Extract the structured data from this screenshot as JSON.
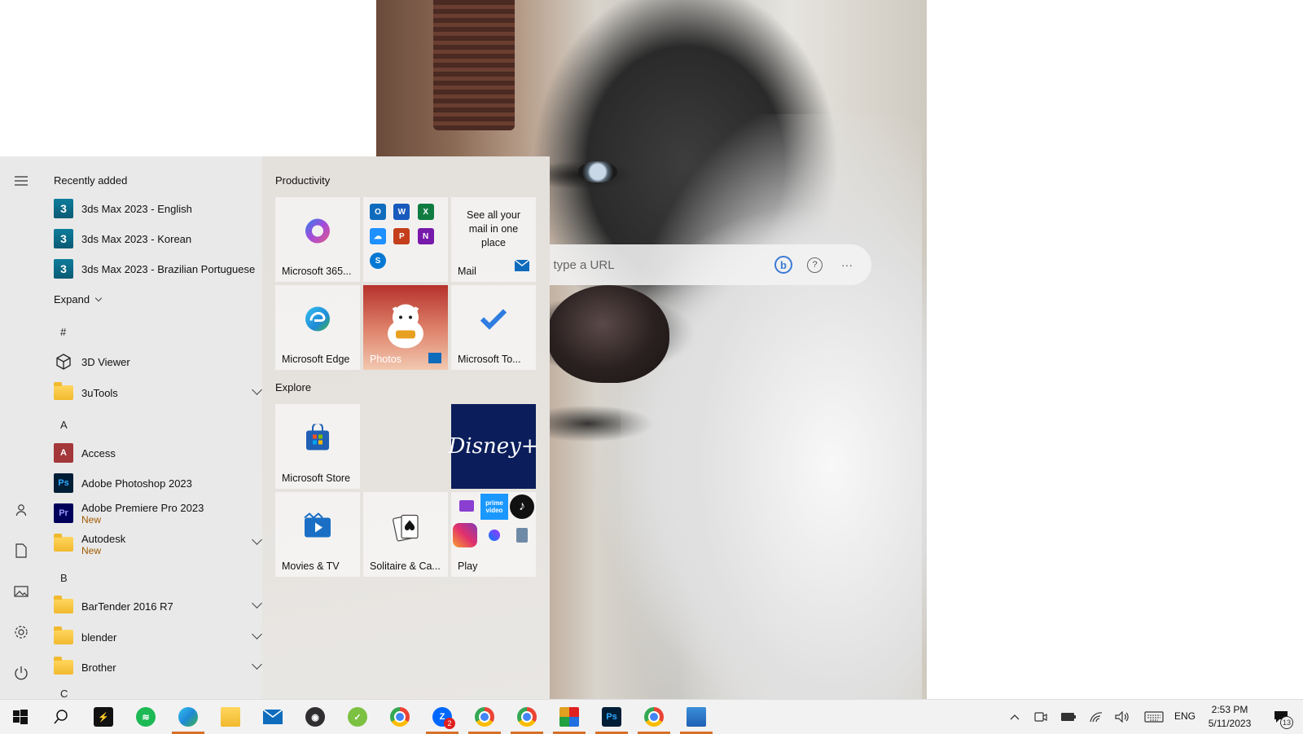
{
  "browser": {
    "search_placeholder": "or type a URL",
    "bing_letter": "b",
    "help_glyph": "?",
    "more_glyph": "···"
  },
  "start": {
    "recently_added_title": "Recently added",
    "recent": [
      {
        "label": "3ds Max 2023 - English",
        "icon": "3ds-max-icon"
      },
      {
        "label": "3ds Max 2023 - Korean",
        "icon": "3ds-max-icon"
      },
      {
        "label": "3ds Max 2023 - Brazilian Portuguese",
        "icon": "3ds-max-icon"
      }
    ],
    "icon_text": {
      "max": "3",
      "access": "A",
      "ps": "Ps",
      "pr": "Pr"
    },
    "expand_label": "Expand",
    "letters": {
      "hash": "#",
      "a": "A",
      "b": "B",
      "c": "C"
    },
    "apps": {
      "viewer3d": "3D Viewer",
      "tools3u": "3uTools",
      "access": "Access",
      "photoshop": "Adobe Photoshop 2023",
      "premiere": "Adobe Premiere Pro 2023",
      "premiere_badge": "New",
      "autodesk": "Autodesk",
      "autodesk_badge": "New",
      "bartender": "BarTender 2016 R7",
      "blender": "blender",
      "brother": "Brother"
    },
    "groups": {
      "productivity": "Productivity",
      "explore": "Explore"
    },
    "tiles": {
      "m365": "Microsoft 365...",
      "mail_promo": "See all your mail in one place",
      "mail": "Mail",
      "edge": "Microsoft Edge",
      "photos": "Photos",
      "todo": "Microsoft To...",
      "store": "Microsoft Store",
      "disney": "Disney+",
      "movies": "Movies & TV",
      "solitaire": "Solitaire & Ca...",
      "play": "Play"
    },
    "office_minis": [
      "O",
      "W",
      "X",
      "☁",
      "P",
      "N",
      "S"
    ],
    "play_mini_text": {
      "prime": "prime video",
      "tiktok": "♪"
    }
  },
  "taskbar": {
    "lang": "ENG",
    "time": "2:53 PM",
    "date": "5/11/2023",
    "zalo_badge": "2",
    "notif_count": "13",
    "pinned": [
      "start-button",
      "search-button",
      "app-red",
      "spotify",
      "edge",
      "file-explorer",
      "mail",
      "obs",
      "app-green",
      "chrome",
      "zalo",
      "chrome-profile-1",
      "chrome-profile-2",
      "app-grid",
      "photoshop",
      "chrome-profile-3",
      "photos"
    ]
  },
  "colors": {
    "accent_underline": "#d6712a",
    "new_badge": "#a15a00",
    "disney_bg": "#0b1e5b"
  }
}
